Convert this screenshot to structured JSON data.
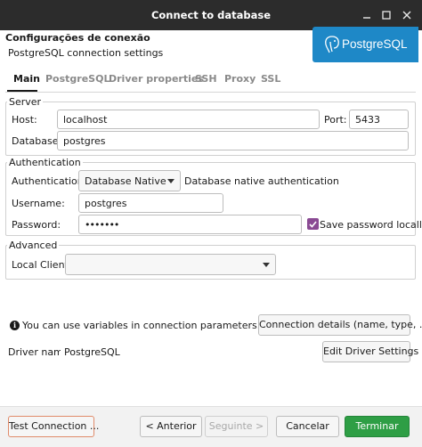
{
  "window": {
    "title": "Connect to database",
    "minimize_icon": "minimize-icon",
    "maximize_icon": "maximize-icon",
    "close_icon": "close-icon"
  },
  "header": {
    "title": "Configurações de conexão",
    "subtitle": "PostgreSQL connection settings",
    "logo_text": "PostgreSQL",
    "logo_color": "#1e88c7"
  },
  "tabs": [
    {
      "label": "Main",
      "active": true
    },
    {
      "label": "PostgreSQL",
      "active": false
    },
    {
      "label": "Driver properties",
      "active": false
    },
    {
      "label": "SSH",
      "active": false
    },
    {
      "label": "Proxy",
      "active": false
    },
    {
      "label": "SSL",
      "active": false
    }
  ],
  "server": {
    "group_label": "Server",
    "host_label": "Host:",
    "host_value": "localhost",
    "port_label": "Port:",
    "port_value": "5433",
    "database_label": "Database:",
    "database_value": "postgres"
  },
  "authentication": {
    "group_label": "Authentication",
    "auth_label": "Authentication:",
    "auth_value": "Database Native",
    "auth_description": "Database native authentication",
    "username_label": "Username:",
    "username_value": "postgres",
    "password_label": "Password:",
    "password_value": "•••••••",
    "save_password_label": "Save password locally",
    "save_password_checked": true
  },
  "advanced": {
    "group_label": "Advanced",
    "local_client_label": "Local Client:",
    "local_client_value": ""
  },
  "info": {
    "text": "You can use variables in connection parameters.",
    "details_button": "Connection details (name, type, ... )"
  },
  "driver": {
    "label": "Driver name:",
    "value": "PostgreSQL",
    "edit_button": "Edit Driver Settings"
  },
  "footer": {
    "test_button": "Test Connection ...",
    "back_button": "< Anterior",
    "next_button": "Seguinte >",
    "cancel_button": "Cancelar",
    "finish_button": "Terminar"
  },
  "colors": {
    "titlebar": "#2c2c2c",
    "accent_green": "#2e9e45",
    "checkbox_purple": "#8a4a93"
  }
}
